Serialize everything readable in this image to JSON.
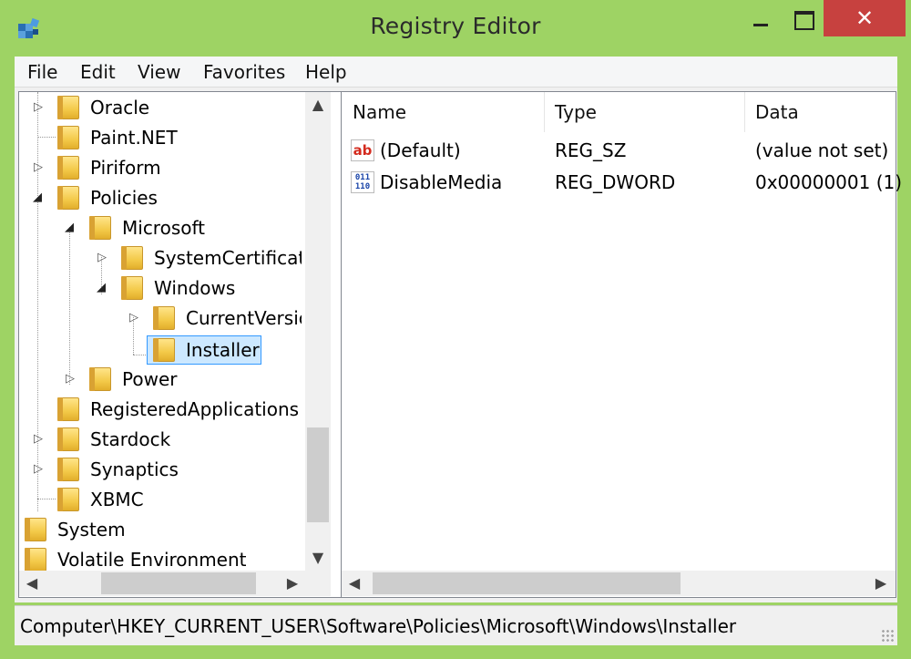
{
  "window": {
    "title": "Registry Editor",
    "close_glyph": "✕"
  },
  "menu": [
    "File",
    "Edit",
    "View",
    "Favorites",
    "Help"
  ],
  "tree": {
    "items": [
      {
        "label": "Oracle",
        "expander": "collapsed"
      },
      {
        "label": "Paint.NET",
        "expander": "none"
      },
      {
        "label": "Piriform",
        "expander": "collapsed"
      },
      {
        "label": "Policies",
        "expander": "expanded"
      },
      {
        "label": "Microsoft",
        "expander": "expanded"
      },
      {
        "label": "SystemCertificate",
        "expander": "collapsed"
      },
      {
        "label": "Windows",
        "expander": "expanded"
      },
      {
        "label": "CurrentVersic",
        "expander": "collapsed"
      },
      {
        "label": "Installer",
        "expander": "none",
        "selected": true
      },
      {
        "label": "Power",
        "expander": "collapsed"
      },
      {
        "label": "RegisteredApplications",
        "expander": "none"
      },
      {
        "label": "Stardock",
        "expander": "collapsed"
      },
      {
        "label": "Synaptics",
        "expander": "collapsed"
      },
      {
        "label": "XBMC",
        "expander": "none"
      },
      {
        "label": "System",
        "expander": "none"
      },
      {
        "label": "Volatile Environment",
        "expander": "none"
      }
    ]
  },
  "list": {
    "columns": [
      "Name",
      "Type",
      "Data"
    ],
    "rows": [
      {
        "icon": "string-value-icon",
        "icon_text": "ab",
        "name": "(Default)",
        "type": "REG_SZ",
        "data": "(value not set)"
      },
      {
        "icon": "binary-value-icon",
        "icon_text": "011\n110",
        "name": "DisableMedia",
        "type": "REG_DWORD",
        "data": "0x00000001 (1)"
      }
    ]
  },
  "status": {
    "path": "Computer\\HKEY_CURRENT_USER\\Software\\Policies\\Microsoft\\Windows\\Installer"
  },
  "colors": {
    "frame": "#9ed364",
    "close": "#c7413f",
    "selection": "#cce8ff"
  }
}
